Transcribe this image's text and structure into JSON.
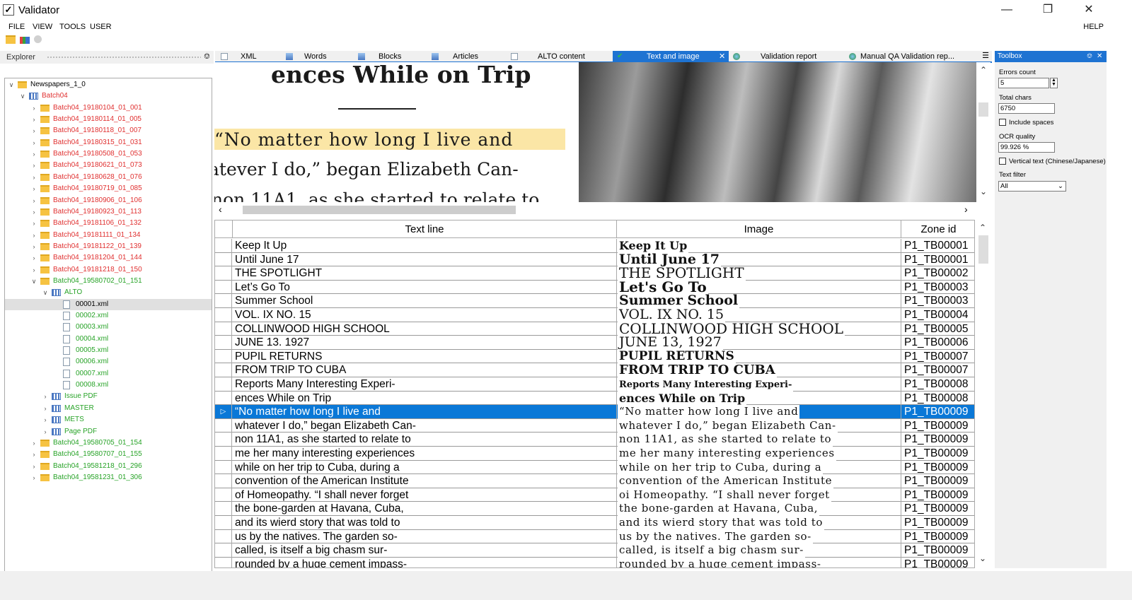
{
  "window": {
    "title": "Validator",
    "app_icon": "checkbox-icon",
    "controls": [
      "minimize-icon",
      "restore-icon",
      "close-icon"
    ]
  },
  "menu": {
    "items": [
      "FILE",
      "VIEW",
      "TOOLS",
      "USER"
    ],
    "help": "HELP"
  },
  "toolbar": {
    "icons": [
      "open-folder-icon",
      "chart-icon",
      "circle-icon"
    ]
  },
  "explorer": {
    "title": "Explorer",
    "tree": [
      {
        "label": "Newspapers_1_0",
        "color": "#000000"
      },
      {
        "label": "Batch04",
        "color": "#e03030"
      },
      {
        "label": "Batch04_19180104_01_001",
        "color": "#e03030"
      },
      {
        "label": "Batch04_19180114_01_005",
        "color": "#e03030"
      },
      {
        "label": "Batch04_19180118_01_007",
        "color": "#e03030"
      },
      {
        "label": "Batch04_19180315_01_031",
        "color": "#e03030"
      },
      {
        "label": "Batch04_19180508_01_053",
        "color": "#e03030"
      },
      {
        "label": "Batch04_19180621_01_073",
        "color": "#e03030"
      },
      {
        "label": "Batch04_19180628_01_076",
        "color": "#e03030"
      },
      {
        "label": "Batch04_19180719_01_085",
        "color": "#e03030"
      },
      {
        "label": "Batch04_19180906_01_106",
        "color": "#e03030"
      },
      {
        "label": "Batch04_19180923_01_113",
        "color": "#e03030"
      },
      {
        "label": "Batch04_19181106_01_132",
        "color": "#e03030"
      },
      {
        "label": "Batch04_19181111_01_134",
        "color": "#e03030"
      },
      {
        "label": "Batch04_19181122_01_139",
        "color": "#e03030"
      },
      {
        "label": "Batch04_19181204_01_144",
        "color": "#e03030"
      },
      {
        "label": "Batch04_19181218_01_150",
        "color": "#e03030"
      },
      {
        "label": "Batch04_19580702_01_151",
        "color": "#27a327"
      },
      {
        "label": "ALTO",
        "color": "#27a327"
      },
      {
        "label": "00001.xml",
        "color": "#000000"
      },
      {
        "label": "00002.xml",
        "color": "#27a327"
      },
      {
        "label": "00003.xml",
        "color": "#27a327"
      },
      {
        "label": "00004.xml",
        "color": "#27a327"
      },
      {
        "label": "00005.xml",
        "color": "#27a327"
      },
      {
        "label": "00006.xml",
        "color": "#27a327"
      },
      {
        "label": "00007.xml",
        "color": "#27a327"
      },
      {
        "label": "00008.xml",
        "color": "#27a327"
      },
      {
        "label": "Issue PDF",
        "color": "#27a327"
      },
      {
        "label": "MASTER",
        "color": "#27a327"
      },
      {
        "label": "METS",
        "color": "#27a327"
      },
      {
        "label": "Page PDF",
        "color": "#27a327"
      },
      {
        "label": "Batch04_19580705_01_154",
        "color": "#27a327"
      },
      {
        "label": "Batch04_19580707_01_155",
        "color": "#27a327"
      },
      {
        "label": "Batch04_19581218_01_296",
        "color": "#27a327"
      },
      {
        "label": "Batch04_19581231_01_306",
        "color": "#27a327"
      }
    ]
  },
  "tabs": [
    {
      "label": "XML",
      "icon": "xml-file-icon"
    },
    {
      "label": "Words",
      "icon": "image-icon"
    },
    {
      "label": "Blocks",
      "icon": "image-icon"
    },
    {
      "label": "Articles",
      "icon": "image-icon"
    },
    {
      "label": "ALTO content",
      "icon": "xml-file-icon"
    },
    {
      "label": "Text and image",
      "icon": "check-icon",
      "active": true
    },
    {
      "label": "Validation report",
      "icon": "globe-icon"
    },
    {
      "label": "Manual QA Validation rep...",
      "icon": "globe-icon"
    }
  ],
  "preview": {
    "lines": [
      "ences While on Trip",
      "“No matter how long I live and",
      "аtever I do,” began Elizabeth Can-",
      "non 11A1, as she started to relate to"
    ]
  },
  "grid": {
    "headers": [
      "Text line",
      "Image",
      "Zone id"
    ],
    "selected_row": 12,
    "rows": [
      {
        "text": "Keep It Up",
        "image": "Keep It Up",
        "zone": "P1_TB00001"
      },
      {
        "text": "Until June 17",
        "image": "Until June 17",
        "zone": "P1_TB00001"
      },
      {
        "text": "THE SPOTLIGHT",
        "image": "THE SPOTLIGHT",
        "zone": "P1_TB00002"
      },
      {
        "text": "Let’s Go To",
        "image": "Let's Go To",
        "zone": "P1_TB00003"
      },
      {
        "text": "Summer School",
        "image": "Summer School",
        "zone": "P1_TB00003"
      },
      {
        "text": "VOL. IX NO. 15",
        "image": "VOL. IX NO. 15",
        "zone": "P1_TB00004"
      },
      {
        "text": "COLLINWOOD HIGH SCHOOL",
        "image": "COLLINWOOD HIGH SCHOOL",
        "zone": "P1_TB00005"
      },
      {
        "text": "JUNE 13. 1927",
        "image": "JUNE 13, 1927",
        "zone": "P1_TB00006"
      },
      {
        "text": "PUPIL RETURNS",
        "image": "PUPIL RETURNS",
        "zone": "P1_TB00007"
      },
      {
        "text": "FROM TRIP TO CUBA",
        "image": "FROM TRIP TO CUBA",
        "zone": "P1_TB00007"
      },
      {
        "text": "Reports Many Interesting Experi-",
        "image": "Reports Many Interesting Experi-",
        "zone": "P1_TB00008"
      },
      {
        "text": "ences While on Trip",
        "image": "ences While on Trip",
        "zone": "P1_TB00008"
      },
      {
        "text": "“No matter how long I live and",
        "image": "“No matter how long I live and",
        "zone": "P1_TB00009"
      },
      {
        "text": "whatever I do,” began Elizabeth Can-",
        "image": "whatever I do,” began Elizabeth Can-",
        "zone": "P1_TB00009"
      },
      {
        "text": "non 11A1, as she started to relate to",
        "image": "non 11A1, as she started to relate to",
        "zone": "P1_TB00009"
      },
      {
        "text": "me her many interesting experiences",
        "image": "me her many interesting experiences",
        "zone": "P1_TB00009"
      },
      {
        "text": "while on her trip to Cuba, during a",
        "image": "while on her trip to Cuba, during a",
        "zone": "P1_TB00009"
      },
      {
        "text": "convention of the American Institute",
        "image": "convention of the American Institute",
        "zone": "P1_TB00009"
      },
      {
        "text": "of Homeopathy. “I shall never forget",
        "image": "oі Homeopathy. “I shall never forget",
        "zone": "P1_TB00009"
      },
      {
        "text": "the bone-garden at Havana, Cuba,",
        "image": "the bone-garden at Havana, Cuba,",
        "zone": "P1_TB00009"
      },
      {
        "text": "and its wierd story that was told to",
        "image": "and its wierd story that was told to",
        "zone": "P1_TB00009"
      },
      {
        "text": "us by the natives. The garden so-",
        "image": "us by the natives. The garden so-",
        "zone": "P1_TB00009"
      },
      {
        "text": "called, is itself a big chasm sur-",
        "image": "called, is itself a big chasm sur-",
        "zone": "P1_TB00009"
      },
      {
        "text": "rounded by a huge cement impass-",
        "image": "rounded by a huge cement impass-",
        "zone": "P1_TB00009"
      }
    ]
  },
  "toolbox": {
    "title": "Toolbox",
    "errors_count_label": "Errors count",
    "errors_count_value": "5",
    "total_chars_label": "Total chars",
    "total_chars_value": "6750",
    "include_spaces_label": "Include spaces",
    "ocr_quality_label": "OCR quality",
    "ocr_quality_value": "99.926 %",
    "vertical_text_label": "Vertical text (Chinese/Japanese)",
    "text_filter_label": "Text filter",
    "text_filter_value": "All"
  }
}
